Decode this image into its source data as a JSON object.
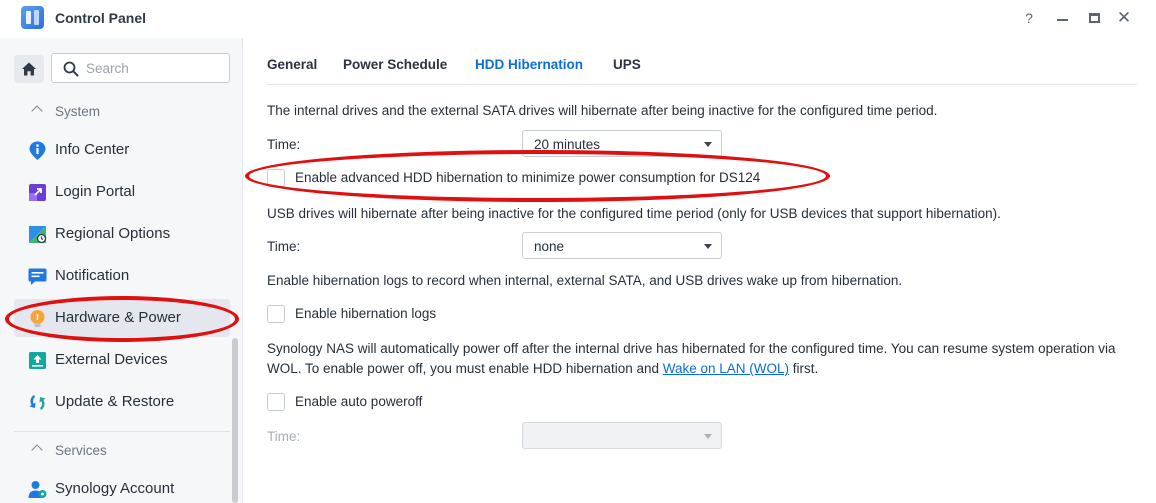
{
  "window": {
    "title": "Control Panel",
    "help_label": "?",
    "close_label": "✕"
  },
  "sidebar": {
    "search_placeholder": "Search",
    "sections": [
      {
        "label": "System"
      },
      {
        "label": "Services"
      }
    ],
    "items": [
      {
        "label": "Info Center",
        "icon": "info-icon"
      },
      {
        "label": "Login Portal",
        "icon": "login-portal-icon"
      },
      {
        "label": "Regional Options",
        "icon": "regional-options-icon"
      },
      {
        "label": "Notification",
        "icon": "notification-icon"
      },
      {
        "label": "Hardware & Power",
        "icon": "lightbulb-icon",
        "active": true
      },
      {
        "label": "External Devices",
        "icon": "external-devices-icon"
      },
      {
        "label": "Update & Restore",
        "icon": "update-restore-icon"
      },
      {
        "label": "Synology Account",
        "icon": "account-icon"
      }
    ]
  },
  "tabs": [
    {
      "label": "General"
    },
    {
      "label": "Power Schedule"
    },
    {
      "label": "HDD Hibernation",
      "active": true
    },
    {
      "label": "UPS"
    }
  ],
  "hibernation": {
    "internal_desc": "The internal drives and the external SATA drives will hibernate after being inactive for the configured time period.",
    "time_label": "Time:",
    "internal_time_value": "20 minutes",
    "advanced_checkbox_label": "Enable advanced HDD hibernation to minimize power consumption for DS124",
    "advanced_checked": false,
    "usb_desc": "USB drives will hibernate after being inactive for the configured time period (only for USB devices that support hibernation).",
    "usb_time_value": "none",
    "logs_desc": "Enable hibernation logs to record when internal, external SATA, and USB drives wake up from hibernation.",
    "logs_checkbox_label": "Enable hibernation logs",
    "logs_checked": false,
    "poweroff_desc": "Synology NAS will automatically power off after the internal drive has hibernated for the configured time. You can resume system operation via WOL. To enable power off, you must enable HDD hibernation and",
    "wol_link": "Wake on LAN (WOL)",
    "poweroff_desc_end": " first.",
    "poweroff_checkbox_label": "Enable auto poweroff",
    "poweroff_checked": false,
    "poweroff_time_value": ""
  },
  "colors": {
    "accent": "#0b6ed6",
    "annotation": "#e01010"
  }
}
